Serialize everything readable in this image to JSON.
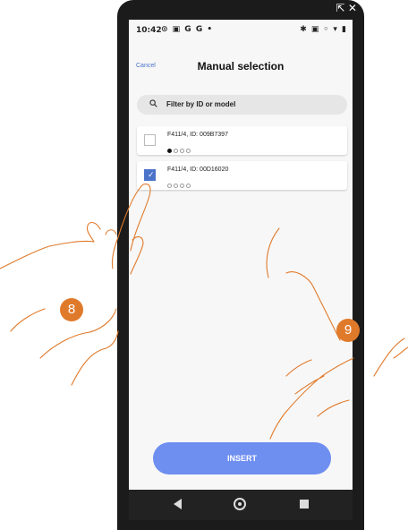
{
  "status_bar": {
    "time": "10:42",
    "left_icons": "⊙ ▣ G G •",
    "right_icons": "✱ ▣ ◦ ▾ ▮"
  },
  "top_overlay_icons": "⇱ ✕",
  "header": {
    "cancel_label": "Cancel",
    "title": "Manual selection"
  },
  "search": {
    "placeholder": "Filter by ID or model"
  },
  "devices": [
    {
      "label": "F411/4, ID: 009B7397",
      "checked": false,
      "active_dot": 1
    },
    {
      "label": "F411/4, ID: 00D16020",
      "checked": true,
      "active_dot": 0
    }
  ],
  "insert_button": {
    "label": "INSERT"
  },
  "steps": {
    "step_a": "8",
    "step_b": "9"
  },
  "colors": {
    "accent": "#4a73c9",
    "button": "#6e8ef0",
    "badge": "#e07a2b",
    "hand_outline": "#e07a2b"
  }
}
